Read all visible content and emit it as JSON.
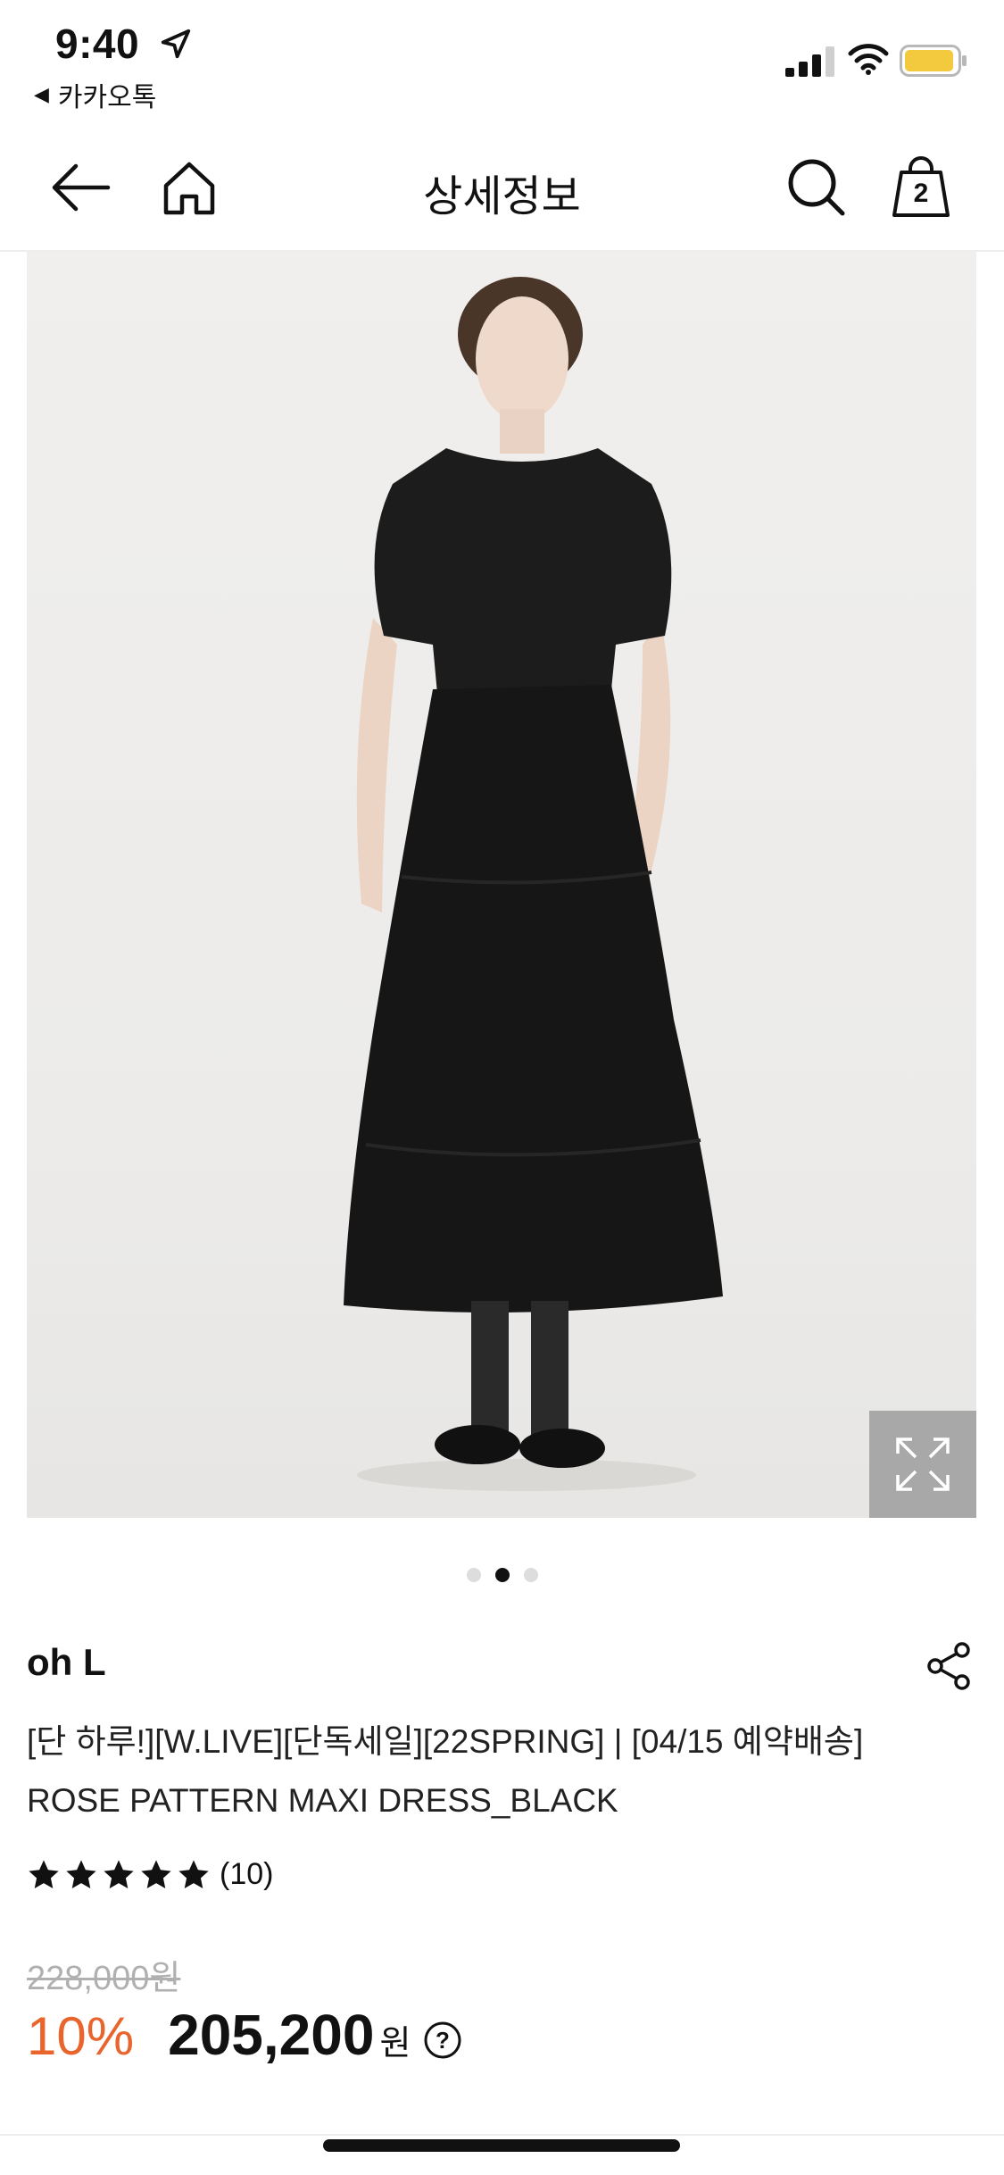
{
  "status_bar": {
    "time": "9:40",
    "back_app_label": "카카오톡",
    "icons": [
      "location-arrow-icon",
      "signal-icon",
      "wifi-icon",
      "battery-icon"
    ],
    "battery_color": "#f3c93e"
  },
  "header": {
    "title": "상세정보",
    "cart_count": "2",
    "icons": [
      "back-arrow-icon",
      "home-icon",
      "search-icon",
      "shopping-bag-icon"
    ]
  },
  "gallery": {
    "active_index": 1,
    "total": 3,
    "expand_icon": "expand-icon"
  },
  "product": {
    "brand": "oh L",
    "title_line1": "[단 하루!][W.LIVE][단독세일][22SPRING] | [04/15 예약배송]",
    "title_line2": "ROSE PATTERN MAXI DRESS_BLACK",
    "rating_stars": 5,
    "review_count": "(10)",
    "original_price": "228,000원",
    "discount": "10%",
    "price": "205,200",
    "currency": "원"
  },
  "colors": {
    "discount": "#e8652e",
    "strike_price": "#b0b0b0"
  }
}
